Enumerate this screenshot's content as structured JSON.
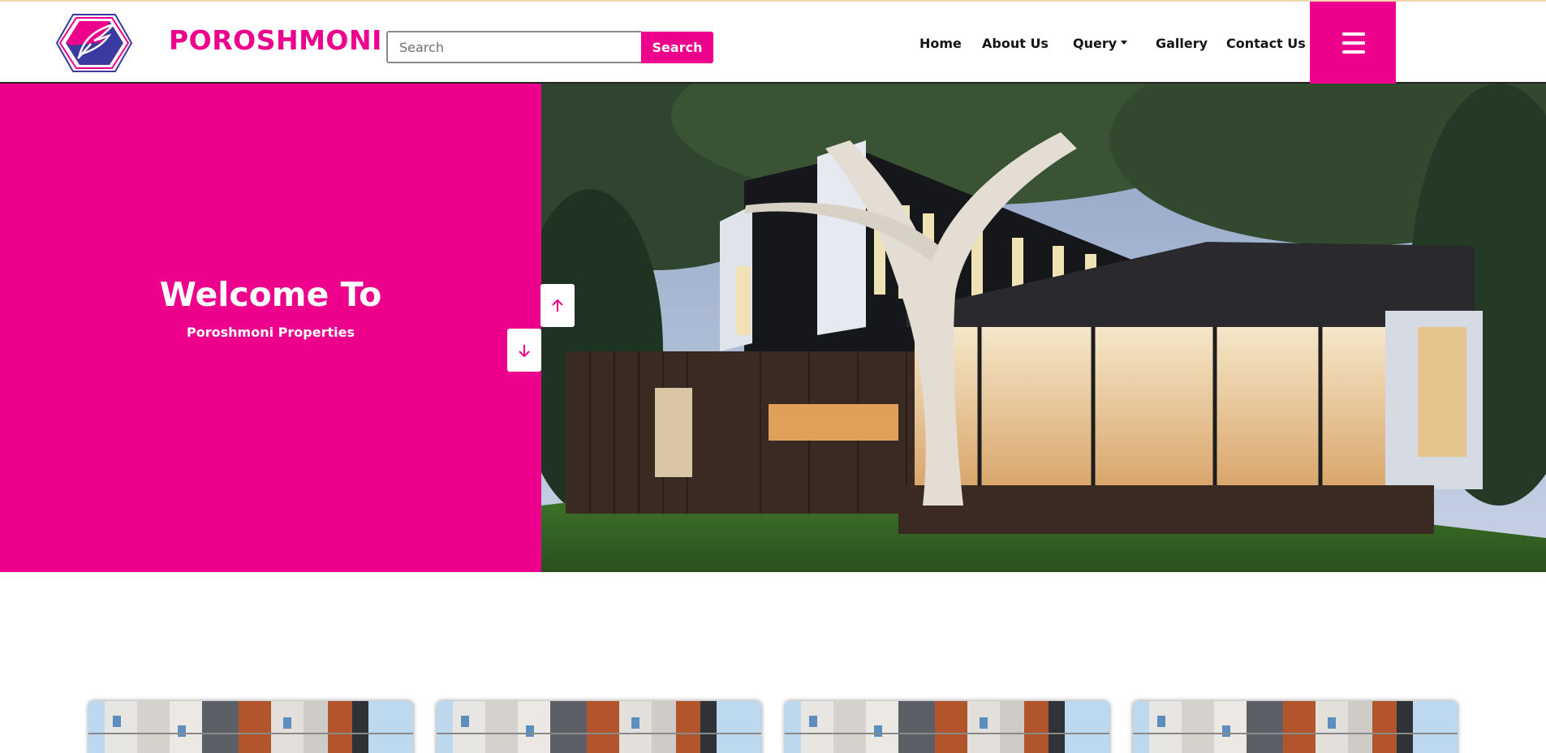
{
  "header": {
    "brand": "POROSHMONI",
    "search": {
      "placeholder": "Search",
      "value": "",
      "button_label": "Search"
    },
    "nav": {
      "home": "Home",
      "about": "About Us",
      "query": "Query",
      "gallery": "Gallery",
      "contact": "Contact Us"
    },
    "menu_icon": "hamburger-icon"
  },
  "hero": {
    "title": "Welcome To",
    "subtitle": "Poroshmoni Properties",
    "prev_icon": "arrow-up-icon",
    "next_icon": "arrow-down-icon"
  },
  "colors": {
    "brand": "#ec008c",
    "logo_blue": "#3a3aa0",
    "text_dark": "#141414"
  },
  "cards": [
    {
      "image": "apartment-building-photo"
    },
    {
      "image": "apartment-building-photo"
    },
    {
      "image": "apartment-building-photo"
    },
    {
      "image": "apartment-building-photo"
    }
  ]
}
